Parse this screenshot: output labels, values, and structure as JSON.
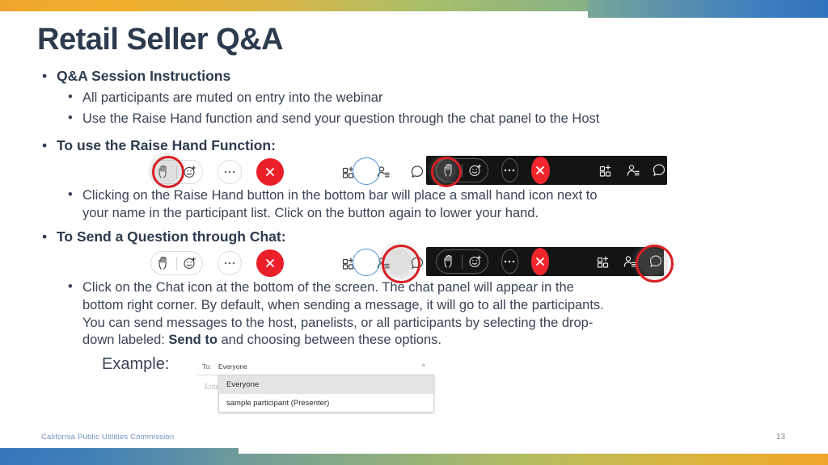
{
  "slide": {
    "title": "Retail Seller Q&A",
    "page_number": "13",
    "footer_text": "California Public Utilities Commission"
  },
  "colors": {
    "title": "#2d3b4e",
    "body": "#3a4454",
    "accent_red": "#d81f26",
    "accent_blue": "#4a90d9",
    "leave_button": "#eb1f29",
    "footer_link": "#6f8fc0",
    "banner_orange": "#f0a52a",
    "banner_green": "#86b187",
    "banner_blue": "#2f72bd"
  },
  "bullets": {
    "b1": "Q&A Session Instructions",
    "b1_sub1": "All participants are muted on entry into the webinar",
    "b1_sub2": "Use the Raise Hand function and send your question through the chat panel to the Host",
    "b2": "To use the Raise Hand Function:",
    "b2_sub1_line1": "Clicking on the Raise Hand button in the bottom bar will place a small hand icon next to",
    "b2_sub1_line2": "your name in the participant list. Click on the button again to lower your hand.",
    "b3": "To Send a Question through Chat:",
    "b3_sub1_line1": "Click on the Chat icon at the bottom of the screen. The chat panel will appear in the",
    "b3_sub1_line2": "bottom right corner. By default, when sending a message, it will go to all the participants.",
    "b3_sub1_line3": "You can send messages to the host, panelists, or all participants by selecting the drop-",
    "b3_sub1_line4_pre": "down labeled: ",
    "b3_sub1_line4_bold": "Send to",
    "b3_sub1_line4_post": " and choosing between these options.",
    "example_label": "Example:"
  },
  "toolbars": {
    "icon_names": {
      "raise_hand": "raise-hand-icon",
      "reactions": "reaction-smiley-plus-icon",
      "more": "more-options-icon",
      "leave": "leave-meeting-close-icon",
      "apps": "apps-grid-plus-icon",
      "participants": "participants-list-icon",
      "chat": "chat-bubble-icon"
    },
    "raise_hand_light": {
      "theme": "light",
      "highlighted_icon": "raise-hand-icon",
      "secondary_highlight": "participants-list-icon"
    },
    "raise_hand_dark": {
      "theme": "dark",
      "highlighted_icon": "raise-hand-icon"
    },
    "chat_light": {
      "theme": "light",
      "highlighted_icon": "chat-bubble-icon",
      "secondary_highlight": "participants-list-icon"
    },
    "chat_dark": {
      "theme": "dark",
      "highlighted_icon": "chat-bubble-icon"
    }
  },
  "chat_dropdown": {
    "to_label": "To:",
    "selected_value": "Everyone",
    "entry_placeholder": "Enter",
    "options": [
      {
        "label": "Everyone",
        "selected": true
      },
      {
        "label": "sample participant (Presenter)",
        "selected": false
      }
    ]
  }
}
